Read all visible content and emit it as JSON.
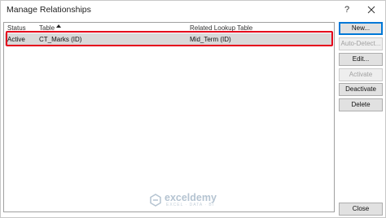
{
  "window": {
    "title": "Manage Relationships",
    "help_label": "?",
    "close_icon": "close-icon"
  },
  "grid": {
    "columns": [
      {
        "label": "Status"
      },
      {
        "label": "Table"
      },
      {
        "label": "Related Lookup Table"
      }
    ],
    "sorted_column": "Table",
    "sort_direction": "ascending",
    "rows": [
      {
        "status": "Active",
        "table": "CT_Marks (ID)",
        "related": "Mid_Term (ID)",
        "selected": true
      }
    ],
    "highlight_color": "#e5001c"
  },
  "buttons": {
    "new": "New...",
    "auto_detect": "Auto-Detect...",
    "edit": "Edit...",
    "activate": "Activate",
    "deactivate": "Deactivate",
    "delete": "Delete",
    "close": "Close"
  },
  "watermark": {
    "name": "exceldemy",
    "tagline": "EXCEL · DATA · BI"
  }
}
